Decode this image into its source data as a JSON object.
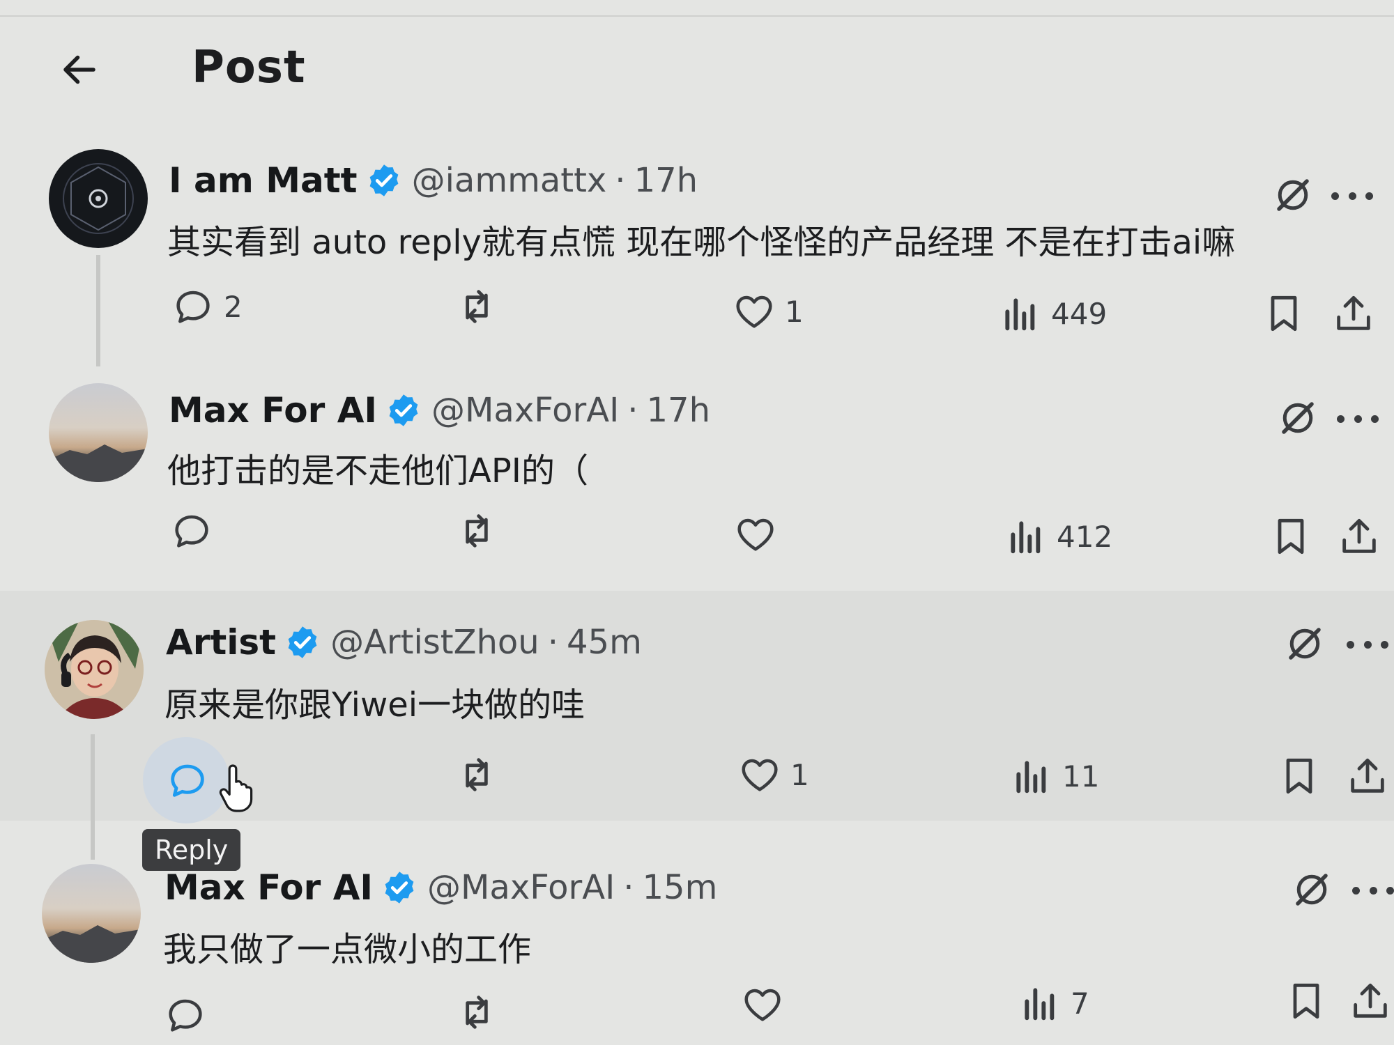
{
  "header": {
    "title": "Post",
    "back_icon": "arrow-left-icon"
  },
  "colors": {
    "accent": "#1d9bf0",
    "verified": "#1d9bf0",
    "text": "#1c1d1f",
    "muted": "#4a4d51"
  },
  "posts": [
    {
      "name": "I am Matt",
      "handle": "@iammattx",
      "time": "17h",
      "text": "其实看到 auto reply就有点慌 现在哪个怪怪的产品经理 不是在打击ai嘛",
      "replies": "2",
      "reposts": "",
      "likes": "1",
      "views": "449"
    },
    {
      "name": "Max For AI",
      "handle": "@MaxForAI",
      "time": "17h",
      "text": "他打击的是不走他们API的（",
      "replies": "",
      "reposts": "",
      "likes": "",
      "views": "412"
    },
    {
      "name": "Artist",
      "handle": "@ArtistZhou",
      "time": "45m",
      "text": "原来是你跟Yiwei一块做的哇",
      "replies": "",
      "reposts": "",
      "likes": "1",
      "views": "11"
    },
    {
      "name": "Max For AI",
      "handle": "@MaxForAI",
      "time": "15m",
      "text": "我只做了一点微小的工作",
      "replies": "",
      "reposts": "",
      "likes": "",
      "views": "7"
    }
  ],
  "tooltip": {
    "text": "Reply"
  },
  "icons": [
    "reply-icon",
    "repost-icon",
    "like-icon",
    "views-icon",
    "bookmark-icon",
    "share-icon",
    "grok-icon",
    "more-icon",
    "verified-icon"
  ]
}
